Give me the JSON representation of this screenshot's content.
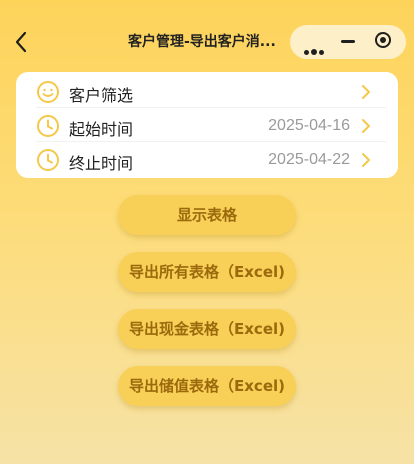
{
  "nav": {
    "title": "客户管理-导出客户消..."
  },
  "filters": [
    {
      "label": "客户筛选",
      "value": "",
      "icon": "smiley-icon"
    },
    {
      "label": "起始时间",
      "value": "2025-04-16",
      "icon": "clock-icon"
    },
    {
      "label": "终止时间",
      "value": "2025-04-22",
      "icon": "clock-icon"
    }
  ],
  "buttons": {
    "show": "显示表格",
    "export_all": "导出所有表格（Excel)",
    "export_cash": "导出现金表格（Excel)",
    "export_stored": "导出储值表格（Excel)"
  },
  "colors": {
    "accent": "#f8cf57",
    "icon": "#f5c84a",
    "button_text": "#9a6a0c"
  }
}
